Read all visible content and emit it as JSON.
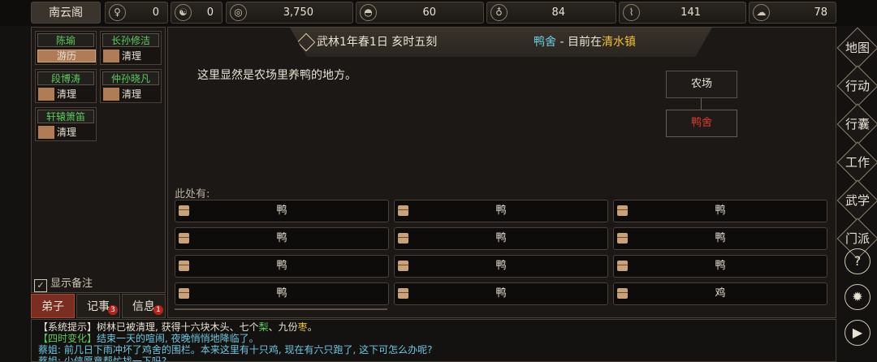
{
  "topbar": {
    "section": "南云阁",
    "stats": [
      {
        "icon": "disciple-icon",
        "glyph": "♀",
        "value": "0"
      },
      {
        "icon": "yin-yang-icon",
        "glyph": "☯",
        "value": "0"
      },
      {
        "icon": "coin-icon",
        "glyph": "◎",
        "value": "3,750"
      },
      {
        "icon": "rice-bowl-icon",
        "glyph": "◓",
        "value": "60"
      },
      {
        "icon": "gourd-icon",
        "glyph": "♁",
        "value": "84"
      },
      {
        "icon": "scroll-icon",
        "glyph": "⌇",
        "value": "141"
      },
      {
        "icon": "stone-icon",
        "glyph": "☁",
        "value": "78"
      }
    ]
  },
  "disciples": [
    {
      "name": "陈瑜",
      "status": "游历",
      "highlight": true
    },
    {
      "name": "长孙修洁",
      "status": "清理",
      "highlight": false
    },
    {
      "name": "段博涛",
      "status": "清理",
      "highlight": false
    },
    {
      "name": "仲孙晓凡",
      "status": "清理",
      "highlight": false
    },
    {
      "name": "轩辕箫笛",
      "status": "清理",
      "highlight": false
    }
  ],
  "show_memo": {
    "label": "显示备注",
    "checked": true
  },
  "tabs": [
    {
      "label": "弟子",
      "badge": ""
    },
    {
      "label": "记事",
      "badge": "3"
    },
    {
      "label": "信息",
      "badge": "1"
    }
  ],
  "location": {
    "date": "武林1年春1日 亥时五刻",
    "place": "鸭舍",
    "sep": " - 目前在",
    "town": "清水镇",
    "description": "这里显然是农场里养鸭的地方。",
    "map_parent": "农场",
    "map_current": "鸭舍"
  },
  "here_label": "此处有:",
  "items": [
    "鸭",
    "鸭",
    "鸭",
    "鸭",
    "鸭",
    "鸭",
    "鸭",
    "鸭",
    "鸭",
    "鸭",
    "鸭",
    "鸡"
  ],
  "right_menu": [
    "地图",
    "行动",
    "行囊",
    "工作",
    "武学",
    "门派"
  ],
  "right_icons": [
    {
      "icon": "help-icon",
      "glyph": "?"
    },
    {
      "icon": "settings-icon",
      "glyph": "✹"
    },
    {
      "icon": "play-icon",
      "glyph": "▶"
    }
  ],
  "log": {
    "line1_prefix": "【系统提示】树林已被清理, 获得十六块木头、七个",
    "line1_pear": "梨",
    "line1_mid": "、九份",
    "line1_date": "枣",
    "line1_end": "。",
    "line2_tag": "【四时变化】",
    "line2_text": "结束一天的喧闹, 夜晚悄悄地降临了。",
    "line3_text": "蔡姐: 前几日下雨冲坏了鸡舍的围栏。本来这里有十只鸡, 现在有六只跑了, 这下可怎么办呢?",
    "line4_text": "蔡姐: 少侠愿意帮忙找一下吗?"
  }
}
